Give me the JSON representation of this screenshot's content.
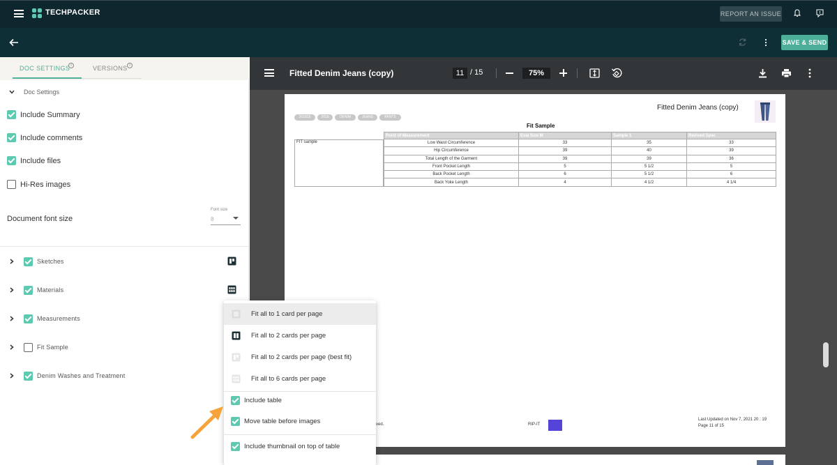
{
  "app": {
    "brand": "TECHPACKER",
    "report_issue": "REPORT AN ISSUE",
    "save_send": "SAVE & SEND"
  },
  "tabs": [
    {
      "label": "DOC SETTINGS",
      "active": true
    },
    {
      "label": "VERSIONS",
      "active": false
    }
  ],
  "doc_settings": {
    "section_label": "Doc Settings",
    "options": [
      {
        "label": "Include Summary",
        "checked": true
      },
      {
        "label": "Include comments",
        "checked": true
      },
      {
        "label": "Include files",
        "checked": true
      },
      {
        "label": "Hi-Res images",
        "checked": false
      }
    ],
    "font_size_label": "Document font size",
    "font_size_caption": "Font size",
    "font_size_value": "8"
  },
  "sections": [
    {
      "label": "Sketches",
      "checked": true,
      "layout_icon": "two-column-layout-icon"
    },
    {
      "label": "Materials",
      "checked": true,
      "layout_icon": "grid-layout-icon"
    },
    {
      "label": "Measurements",
      "checked": true,
      "layout_icon": ""
    },
    {
      "label": "Fit Sample",
      "checked": false,
      "layout_icon": ""
    },
    {
      "label": "Denim Washes and Treatment",
      "checked": true,
      "layout_icon": ""
    }
  ],
  "viewer": {
    "title": "Fitted Denim Jeans (copy)",
    "current_page": "11",
    "total_pages": "/ 15",
    "zoom": "75%"
  },
  "pdf": {
    "title": "Fitted Denim Jeans (copy)",
    "tags": [
      "201819",
      "2019",
      "DENIM",
      "JEANS",
      "PANTS"
    ],
    "table_title": "Fit Sample",
    "row_label": "FIT sample",
    "headers": [
      "Point of Measurement",
      "Eval Size M",
      "Sample 1",
      "Revised Spec"
    ],
    "rows": [
      [
        "Low Waist Circumference",
        "33",
        "35",
        "33"
      ],
      [
        "Hip Circumference",
        "39",
        "40",
        "39"
      ],
      [
        "Total Length of the Garment",
        "39",
        "39",
        "36"
      ],
      [
        "Front Pocket Length",
        "5",
        "5 1/2",
        "5"
      ],
      [
        "Back Pocket Length",
        "6",
        "5 1/2",
        "6"
      ],
      [
        "Back Yoke Length",
        "4",
        "4 1/2",
        "4 1/4"
      ]
    ],
    "footer_left": "rved.",
    "footer_mid": "RIP-IT",
    "footer_updated": "Last Updated on Nov 7, 2021 20 : 19",
    "footer_page": "Page 11 of 15"
  },
  "dropdown": {
    "layout_options": [
      {
        "label": "Fit all to 1 card per page",
        "icon": "single-card-icon",
        "highlighted": true
      },
      {
        "label": "Fit all to 2 cards per page",
        "icon": "two-cards-icon",
        "highlighted": false
      },
      {
        "label": "Fit all to 2 cards per page (best fit)",
        "icon": "two-cards-best-fit-icon",
        "highlighted": false
      },
      {
        "label": "Fit all to 6 cards per page",
        "icon": "six-cards-icon",
        "highlighted": false
      }
    ],
    "checkbox_options": [
      {
        "label": "Include table",
        "checked": true
      },
      {
        "label": "Move table before images",
        "checked": true
      },
      {
        "label": "Include thumbnail on top of table",
        "checked": true
      }
    ]
  },
  "colors": {
    "topbar": "#0e262d",
    "accent": "#4dae9a",
    "checkbox": "#5cc9b0",
    "annotation_arrow": "#f5a33a"
  }
}
